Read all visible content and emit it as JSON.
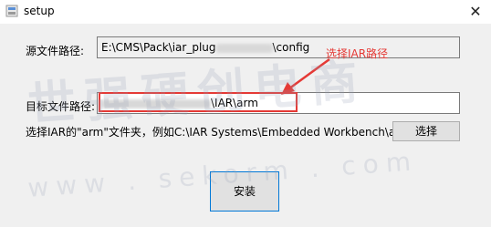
{
  "window": {
    "title": "setup",
    "close_glyph": "✕"
  },
  "source": {
    "label": "源文件路径:",
    "value_prefix": "E:\\CMS\\Pack\\iar_plug",
    "value_suffix": "\\config"
  },
  "target": {
    "label": "目标文件路径:",
    "value_suffix": "\\IAR\\arm"
  },
  "hint": "选择IAR的\"arm\"文件夹，例如C:\\IAR Systems\\Embedded Workbench\\arm",
  "buttons": {
    "select": "选择",
    "install": "安装"
  },
  "annotation": {
    "text": "选择IAR路径",
    "color": "#e53935"
  },
  "watermark": {
    "cn": "世强硬创电商",
    "en": "www . sekorm . com"
  }
}
